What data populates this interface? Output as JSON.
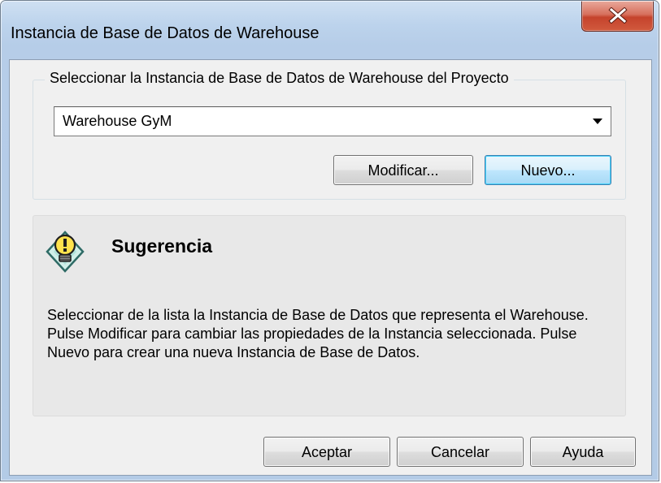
{
  "window": {
    "title": "Instancia de Base de Datos de Warehouse",
    "close_label": "X"
  },
  "group": {
    "legend": "Seleccionar la Instancia de Base de Datos de Warehouse del Proyecto",
    "combo_value": "Warehouse GyM",
    "modify_label": "Modificar...",
    "new_label": "Nuevo..."
  },
  "hint": {
    "icon": "lightbulb-icon",
    "title": "Sugerencia",
    "text": "Seleccionar de la lista la Instancia de Base de Datos que representa el Warehouse. Pulse Modificar para cambiar las propiedades de la Instancia seleccionada. Pulse Nuevo para crear una nueva Instancia de Base de Datos."
  },
  "footer": {
    "accept_label": "Aceptar",
    "cancel_label": "Cancelar",
    "help_label": "Ayuda"
  }
}
